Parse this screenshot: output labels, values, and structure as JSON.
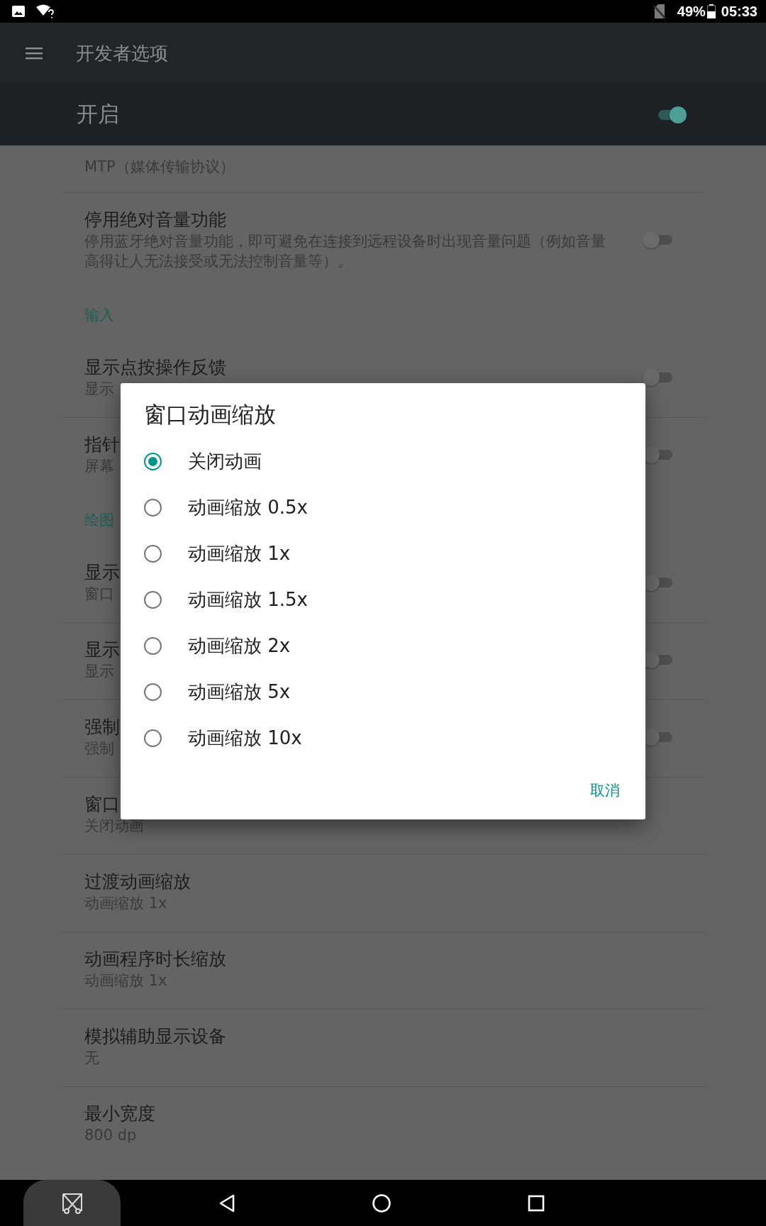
{
  "status_bar": {
    "battery": "49%",
    "time": "05:33"
  },
  "app_bar": {
    "title": "开发者选项"
  },
  "master_switch": {
    "label": "开启",
    "on": true
  },
  "settings": [
    {
      "kind": "item",
      "summary": "MTP（媒体传输协议）"
    },
    {
      "kind": "toggle",
      "title": "停用绝对音量功能",
      "summary": "停用蓝牙绝对音量功能，即可避免在连接到远程设备时出现音量问题（例如音量高得让人无法接受或无法控制音量等）。",
      "on": false
    },
    {
      "kind": "category",
      "title": "输入"
    },
    {
      "kind": "toggle",
      "title": "显示点按操作反馈",
      "summary": "显示",
      "on": false
    },
    {
      "kind": "toggle",
      "title": "指针",
      "summary": "屏幕",
      "on": false
    },
    {
      "kind": "category",
      "title": "绘图"
    },
    {
      "kind": "toggle",
      "title": "显示",
      "summary": "窗口",
      "on": false
    },
    {
      "kind": "toggle",
      "title": "显示",
      "summary": "显示",
      "on": false
    },
    {
      "kind": "toggle",
      "title": "强制",
      "summary": "强制",
      "on": false
    },
    {
      "kind": "item",
      "title": "窗口",
      "summary": "关闭动画"
    },
    {
      "kind": "item",
      "title": "过渡动画缩放",
      "summary": "动画缩放 1x"
    },
    {
      "kind": "item",
      "title": "动画程序时长缩放",
      "summary": "动画缩放 1x"
    },
    {
      "kind": "item",
      "title": "模拟辅助显示设备",
      "summary": "无"
    },
    {
      "kind": "item",
      "title": "最小宽度",
      "summary": "800 dp"
    }
  ],
  "dialog": {
    "title": "窗口动画缩放",
    "options": [
      {
        "label": "关闭动画",
        "selected": true
      },
      {
        "label": "动画缩放 0.5x",
        "selected": false
      },
      {
        "label": "动画缩放 1x",
        "selected": false
      },
      {
        "label": "动画缩放 1.5x",
        "selected": false
      },
      {
        "label": "动画缩放 2x",
        "selected": false
      },
      {
        "label": "动画缩放 5x",
        "selected": false
      },
      {
        "label": "动画缩放 10x",
        "selected": false
      }
    ],
    "cancel": "取消"
  }
}
